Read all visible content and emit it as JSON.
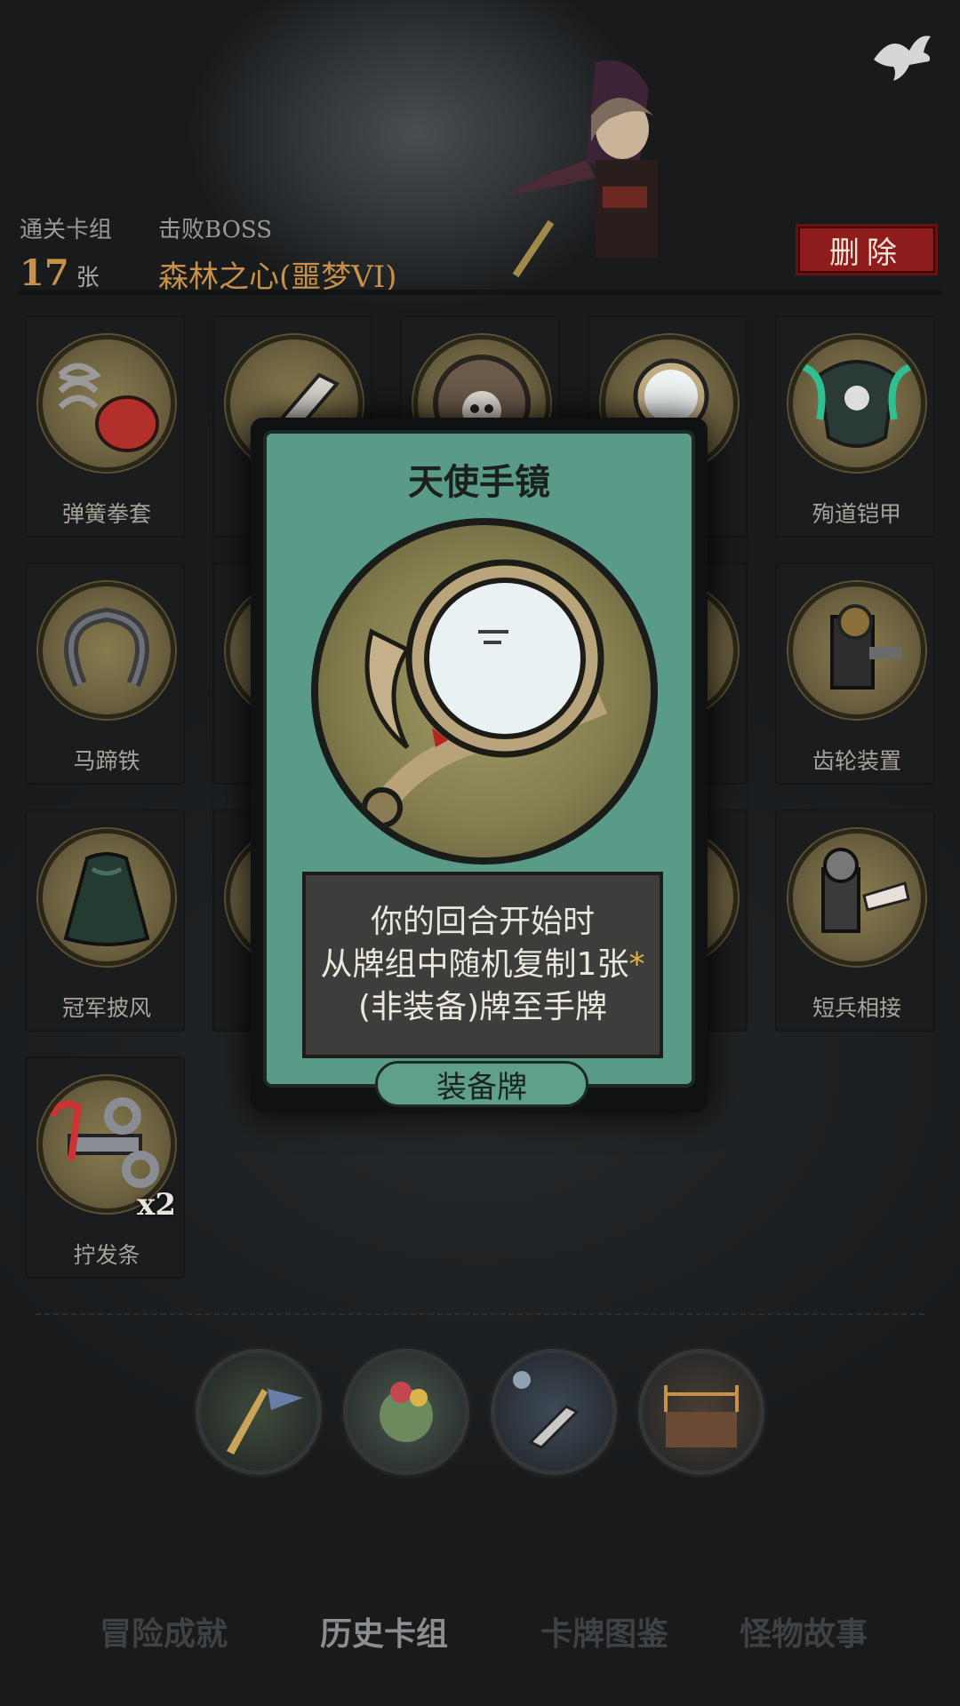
{
  "header": {
    "cleared_deck_label": "通关卡组",
    "cleared_deck_count": "17",
    "cleared_deck_unit": "张",
    "defeated_boss_label": "击败BOSS",
    "defeated_boss_name": "森林之心(噩梦VI)",
    "delete_button": "删除"
  },
  "cards": [
    {
      "name": "弹簧拳套",
      "icon": "boxing-glove-icon",
      "count": ""
    },
    {
      "name": "",
      "icon": "dagger-icon",
      "count": ""
    },
    {
      "name": "",
      "icon": "skull-shield-icon",
      "count": ""
    },
    {
      "name": "",
      "icon": "mirror-icon",
      "count": ""
    },
    {
      "name": "殉道铠甲",
      "icon": "armor-icon",
      "count": ""
    },
    {
      "name": "马蹄铁",
      "icon": "horseshoe-icon",
      "count": ""
    },
    {
      "name": "",
      "icon": "hidden-card-icon",
      "count": ""
    },
    {
      "name": "",
      "icon": "hidden-card-icon",
      "count": ""
    },
    {
      "name": "",
      "icon": "hidden-card-icon",
      "count": ""
    },
    {
      "name": "齿轮装置",
      "icon": "gear-device-icon",
      "count": ""
    },
    {
      "name": "冠军披风",
      "icon": "cape-icon",
      "count": ""
    },
    {
      "name": "",
      "icon": "hidden-card-icon",
      "count": ""
    },
    {
      "name": "",
      "icon": "hidden-card-icon",
      "count": ""
    },
    {
      "name": "",
      "icon": "hidden-card-icon",
      "count": ""
    },
    {
      "name": "短兵相接",
      "icon": "knight-icon",
      "count": ""
    },
    {
      "name": "拧发条",
      "icon": "wind-up-key-icon",
      "count": "x2"
    }
  ],
  "card_detail": {
    "title": "天使手镜",
    "icon": "angel-mirror-icon",
    "desc_line1": "你的回合开始时",
    "desc_line2": "从牌组中随机复制1张",
    "desc_star": "*",
    "desc_line3": "(非装备)牌至手牌",
    "type": "装备牌"
  },
  "bosses": [
    "warrior-banner-icon",
    "forest-spirit-icon",
    "blade-icon",
    "boxing-ring-icon"
  ],
  "tabs": [
    {
      "label": "冒险成就",
      "active": false
    },
    {
      "label": "历史卡组",
      "active": true
    },
    {
      "label": "卡牌图鉴",
      "active": false
    },
    {
      "label": "怪物故事",
      "active": false
    }
  ],
  "colors": {
    "accent": "#c79147",
    "card_frame": "#5a9a88",
    "delete": "#8e1c1c"
  }
}
